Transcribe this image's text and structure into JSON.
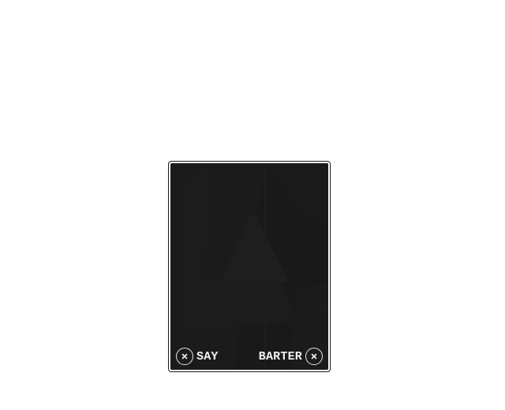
{
  "dialog": {
    "say_label": "SAY",
    "barter_label": "BARTER",
    "say_icon": "close-x-icon",
    "barter_icon": "close-x-icon",
    "colors": {
      "panel_background": "#191919",
      "panel_border": "#1b1b1b",
      "text": "#f2f2f2",
      "page_background": "#ffffff"
    }
  }
}
